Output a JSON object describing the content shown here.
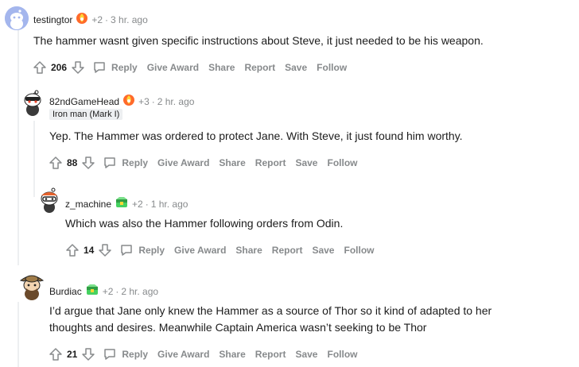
{
  "comments": [
    {
      "username": "testingtor",
      "score_badge": "+2",
      "time": "3 hr. ago",
      "flair": "",
      "body": "The hammer wasnt given specific instructions about Steve, it just needed to be his weapon.",
      "votes": "206",
      "award_icon": "gold-flame-award"
    },
    {
      "username": "82ndGameHead",
      "score_badge": "+3",
      "time": "2 hr. ago",
      "flair": "Iron man (Mark I)",
      "body": "Yep. The Hammer was ordered to protect Jane. With Steve, it just found him worthy.",
      "votes": "88",
      "award_icon": "gold-flame-award"
    },
    {
      "username": "z_machine",
      "score_badge": "+2",
      "time": "1 hr. ago",
      "flair": "",
      "body": "Which was also the Hammer following orders from Odin.",
      "votes": "14",
      "award_icon": "green-treasure-award"
    },
    {
      "username": "Burdiac",
      "score_badge": "+2",
      "time": "2 hr. ago",
      "flair": "",
      "body": "I’d argue that Jane only knew the Hammer as a source of Thor so it kind of adapted to her thoughts and desires. Meanwhile Captain America wasn’t seeking to be Thor",
      "votes": "21",
      "award_icon": "green-treasure-award"
    }
  ],
  "actions": {
    "reply": "Reply",
    "give_award": "Give Award",
    "share": "Share",
    "report": "Report",
    "save": "Save",
    "follow": "Follow"
  },
  "separator": "·",
  "colors": {
    "meta_gray": "#878a8c",
    "text": "#1c1c1c",
    "thread_line": "#edeff1",
    "flair_bg": "#edeff1"
  }
}
